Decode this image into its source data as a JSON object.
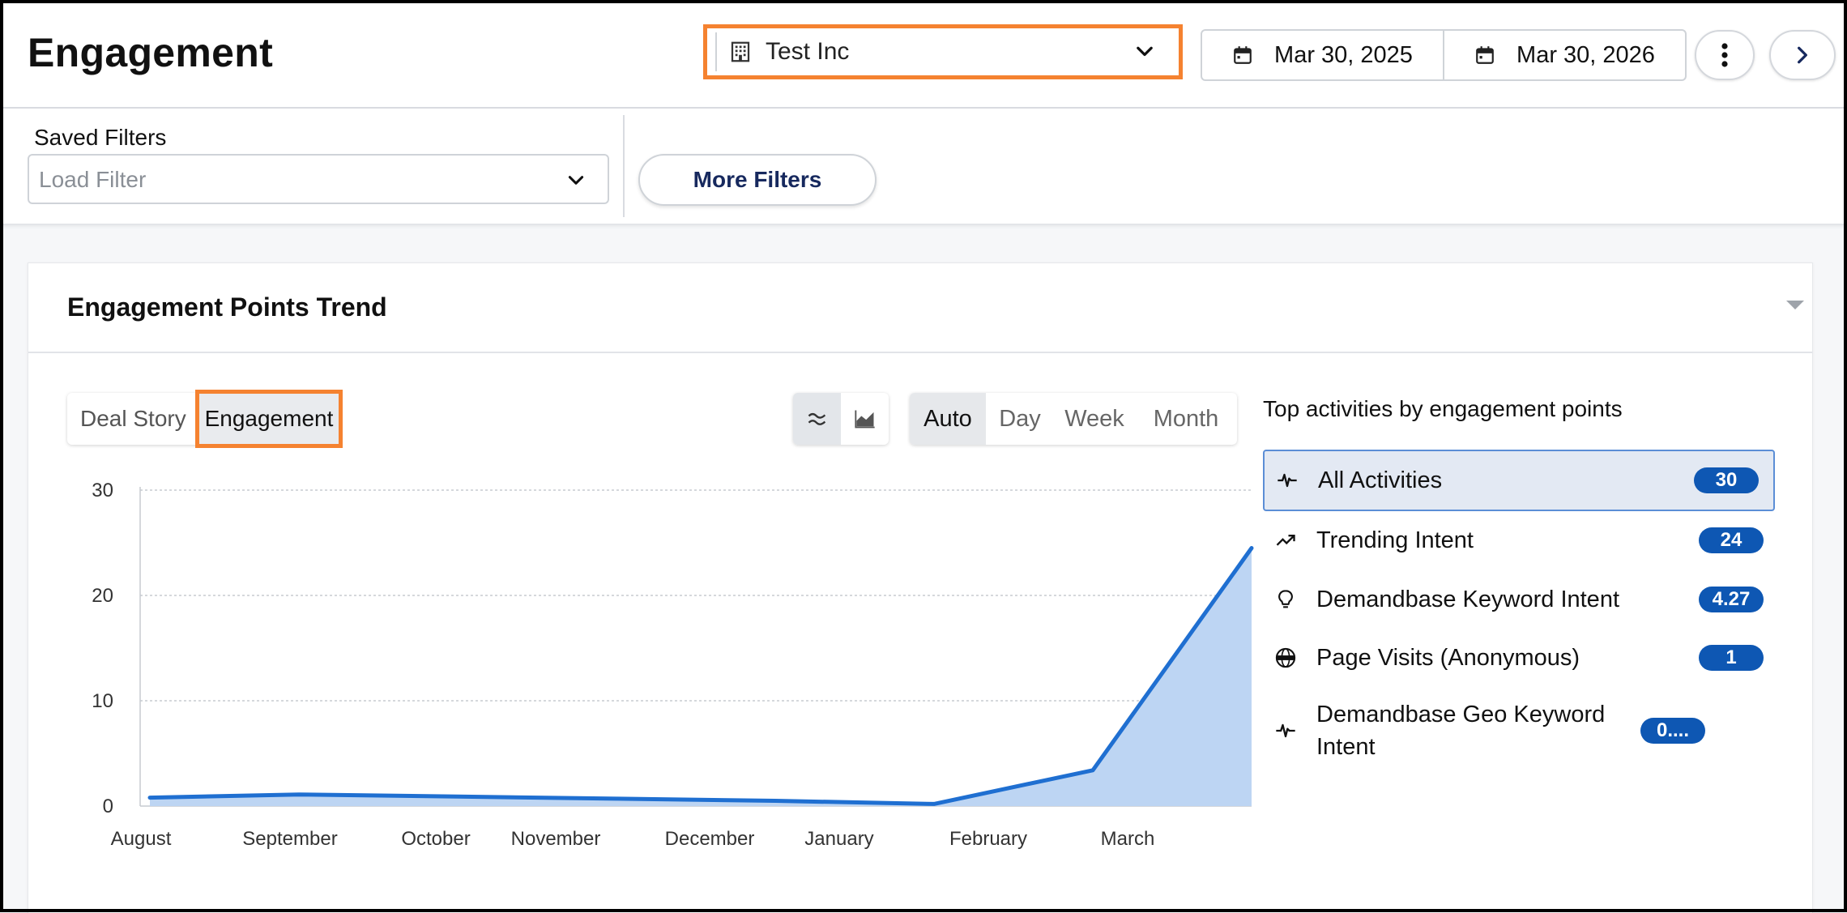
{
  "header": {
    "title": "Engagement",
    "company": "Test Inc",
    "start_date": "Mar 30, 2025",
    "end_date": "Mar 30, 2026"
  },
  "filters": {
    "saved_label": "Saved Filters",
    "load_placeholder": "Load Filter",
    "more_label": "More Filters"
  },
  "card": {
    "title": "Engagement Points Trend",
    "tabs": [
      "Deal Story",
      "Engagement"
    ],
    "granularity": [
      "Auto",
      "Day",
      "Week",
      "Month"
    ],
    "activities_title": "Top activities by engagement points",
    "activities": [
      {
        "label": "All Activities",
        "value": "30",
        "icon": "pulse-icon",
        "selected": true
      },
      {
        "label": "Trending Intent",
        "value": "24",
        "icon": "trending-up-icon"
      },
      {
        "label": "Demandbase Keyword Intent",
        "value": "4.27",
        "icon": "lightbulb-icon"
      },
      {
        "label": "Page Visits (Anonymous)",
        "value": "1",
        "icon": "www-globe-icon"
      },
      {
        "label": "Demandbase Geo Keyword Intent",
        "value": "0....",
        "icon": "pulse-icon"
      }
    ]
  },
  "colors": {
    "highlight": "#f58230",
    "line": "#1f6fd1",
    "area": "#bdd5f3",
    "badge": "#0e57b3"
  },
  "chart_data": {
    "type": "area",
    "categories": [
      "August",
      "September",
      "October",
      "November",
      "December",
      "January",
      "February",
      "March"
    ],
    "values": [
      0.8,
      1.1,
      0.9,
      0.7,
      0.5,
      0.2,
      3.4,
      24.5
    ],
    "ylim": [
      0,
      30
    ],
    "yticks": [
      0,
      10,
      20,
      30
    ],
    "grid": true,
    "legend": "none"
  }
}
